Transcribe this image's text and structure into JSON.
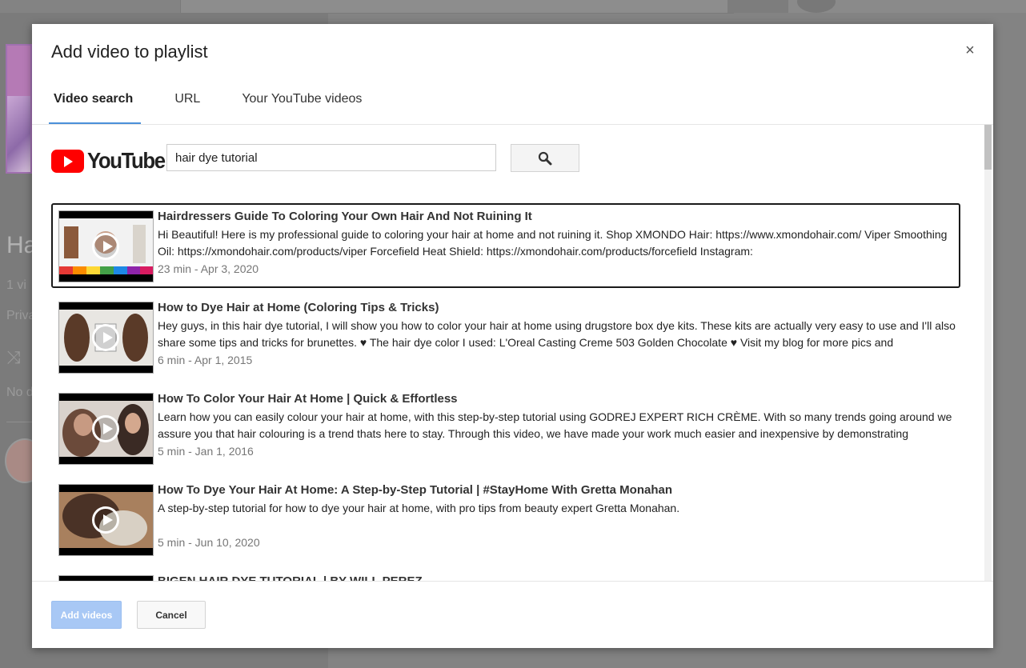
{
  "background": {
    "title_partial": "Ha",
    "videos_partial": "1 vi",
    "privacy_partial": "Priva",
    "desc_partial": "No d"
  },
  "dialog": {
    "title": "Add video to playlist",
    "close_symbol": "×",
    "tabs": [
      {
        "label": "Video search",
        "active": true
      },
      {
        "label": "URL",
        "active": false
      },
      {
        "label": "Your YouTube videos",
        "active": false
      }
    ],
    "search": {
      "logo_text": "YouTube",
      "query": "hair dye tutorial",
      "button_icon": "search-icon"
    },
    "results": [
      {
        "title": "Hairdressers Guide To Coloring Your Own Hair And Not Ruining It",
        "description": "Hi Beautiful! Here is my professional guide to coloring your hair at home and not ruining it. Shop XMONDO Hair: https://www.xmondohair.com/ Viper Smoothing Oil: https://xmondohair.com/products/viper Forcefield Heat Shield: https://xmondohair.com/products/forcefield Instagram:",
        "meta": "23 min - Apr 3, 2020",
        "selected": true
      },
      {
        "title": "How to Dye Hair at Home (Coloring Tips & Tricks)",
        "description": "Hey guys, in this hair dye tutorial, I will show you how to color your hair at home using drugstore box dye kits. These kits are actually very easy to use and I'll also share some tips and tricks for brunettes. ♥ The hair dye color I used: L'Oreal Casting Creme 503 Golden Chocolate ♥ Visit my blog for more pics and",
        "meta": "6 min - Apr 1, 2015",
        "selected": false
      },
      {
        "title": "How To Color Your Hair At Home | Quick & Effortless",
        "description": "Learn how you can easily colour your hair at home, with this step-by-step tutorial using GODREJ EXPERT RICH CRÈME. With so many trends going around we assure you that hair colouring is a trend thats here to stay. Through this video, we have made your work much easier and inexpensive by demonstrating",
        "meta": "5 min - Jan 1, 2016",
        "selected": false
      },
      {
        "title": "How To Dye Your Hair At Home: A Step-by-Step Tutorial | #StayHome With Gretta Monahan",
        "description": "A step-by-step tutorial for how to dye your hair at home, with pro tips from beauty expert Gretta Monahan.",
        "meta": "5 min - Jun 10, 2020",
        "selected": false
      },
      {
        "title": "BIGEN HAIR DYE TUTORIAL | BY WILL PEREZ",
        "description": "",
        "meta": "",
        "selected": false
      }
    ],
    "footer": {
      "add_label": "Add videos",
      "cancel_label": "Cancel"
    }
  }
}
